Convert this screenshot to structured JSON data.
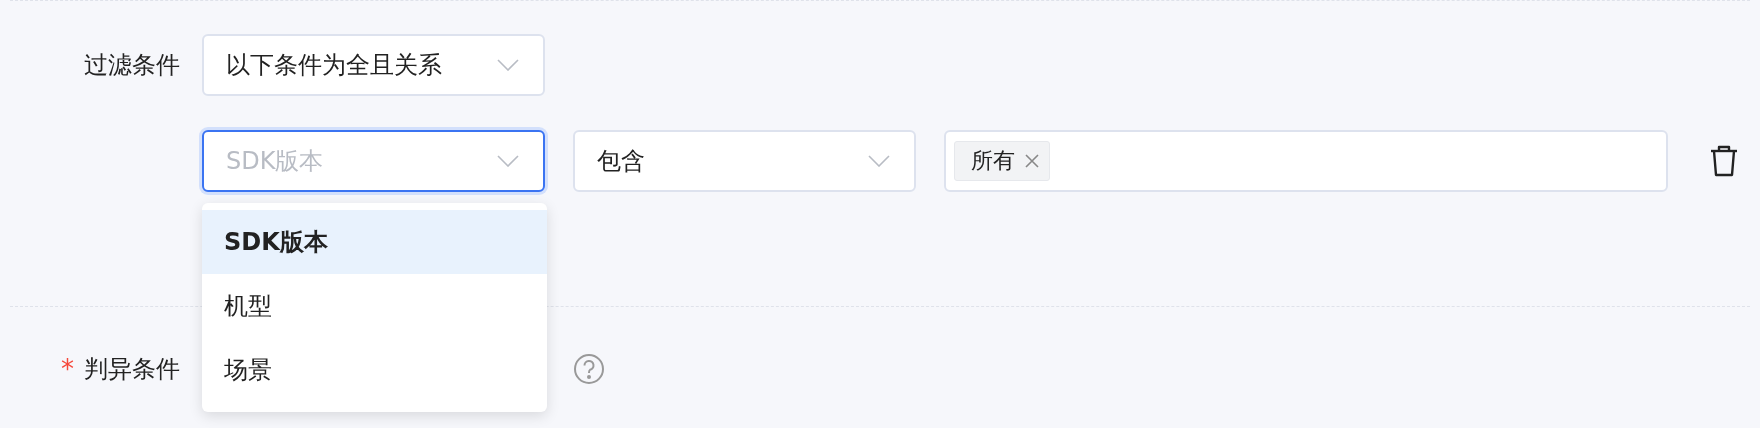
{
  "filter": {
    "label": "过滤条件",
    "mode_select": {
      "value": "以下条件为全且关系"
    }
  },
  "condition": {
    "field_select": {
      "placeholder": "SDK版本",
      "focused": true
    },
    "operator_select": {
      "value": "包含"
    },
    "values": [
      {
        "label": "所有"
      }
    ]
  },
  "dropdown": {
    "options": [
      {
        "label": "SDK版本",
        "selected": true
      },
      {
        "label": "机型",
        "selected": false
      },
      {
        "label": "场景",
        "selected": false
      }
    ]
  },
  "judge": {
    "required_mark": "*",
    "label": "判异条件"
  }
}
